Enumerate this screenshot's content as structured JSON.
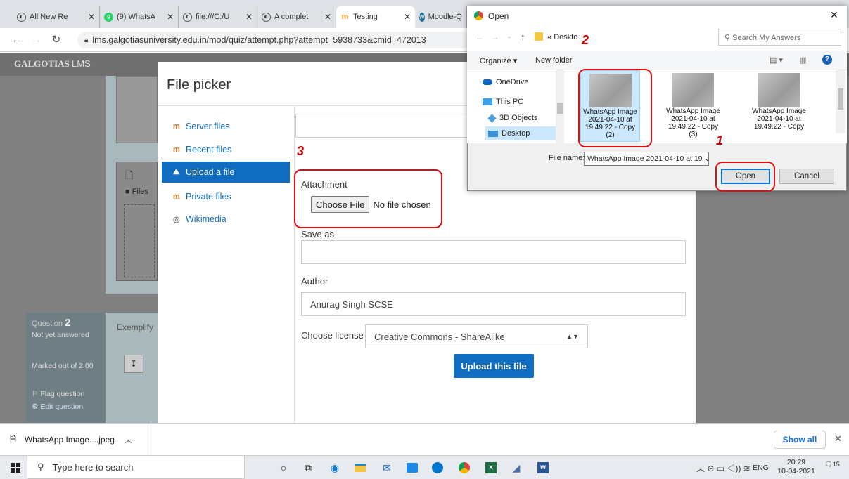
{
  "browser": {
    "tabs": [
      {
        "label": "All New Re",
        "icon": "globe-icon"
      },
      {
        "label": "(9) WhatsA",
        "icon": "whatsapp-icon"
      },
      {
        "label": "file:///C:/U",
        "icon": "globe-icon"
      },
      {
        "label": "A complet",
        "icon": "globe-icon"
      },
      {
        "label": "Testing",
        "icon": "moodle-icon"
      },
      {
        "label": "Moodle-Q",
        "icon": "wordpress-icon"
      }
    ],
    "url": "lms.galgotiasuniversity.edu.in/mod/quiz/attempt.php?attempt=5938733&cmid=472013"
  },
  "lms": {
    "logo": "GALGOTIAS",
    "logo_suffix": "LMS",
    "question_label": "Question",
    "question_number": "2",
    "status": "Not yet answered",
    "marked": "Marked out of 2.00",
    "flag": "Flag question",
    "edit": "Edit question",
    "exemplify": "Exemplify",
    "files_label": "Files"
  },
  "file_picker": {
    "title": "File picker",
    "repositories": [
      {
        "label": "Server files",
        "icon": "moodle-icon"
      },
      {
        "label": "Recent files",
        "icon": "moodle-icon"
      },
      {
        "label": "Upload a file",
        "icon": "upload-icon"
      },
      {
        "label": "Private files",
        "icon": "moodle-icon"
      },
      {
        "label": "Wikimedia",
        "icon": "wikimedia-icon"
      }
    ],
    "attachment_label": "Attachment",
    "choose_file_button": "Choose File",
    "no_file_text": "No file chosen",
    "save_as_label": "Save as",
    "save_as_value": "",
    "author_label": "Author",
    "author_value": "Anurag Singh SCSE",
    "license_label": "Choose license",
    "license_value": "Creative Commons - ShareAlike",
    "upload_button": "Upload this file"
  },
  "open_dialog": {
    "title": "Open",
    "path": "Deskto",
    "search_placeholder": "Search My Answers",
    "organize": "Organize",
    "new_folder": "New folder",
    "nav_items": [
      "OneDrive",
      "This PC",
      "3D Objects",
      "Desktop"
    ],
    "files": [
      {
        "name": "WhatsApp Image 2021-04-10 at 19.49.22 - Copy (2)"
      },
      {
        "name": "WhatsApp Image 2021-04-10 at 19.49.22 - Copy (3)"
      },
      {
        "name": "WhatsApp Image 2021-04-10 at 19.49.22 - Copy"
      }
    ],
    "file_name_label": "File name:",
    "file_name_value": "WhatsApp Image 2021-04-10 at 19",
    "open_button": "Open",
    "cancel_button": "Cancel"
  },
  "annotations": {
    "one": "1",
    "two": "2",
    "three": "3"
  },
  "download_bar": {
    "file": "WhatsApp Image....jpeg",
    "show_all": "Show all"
  },
  "taskbar": {
    "search_placeholder": "Type here to search",
    "time": "20:29",
    "date": "10-04-2021",
    "lang": "ENG",
    "notifications": "15"
  },
  "colors": {
    "accent": "#0f6cbf",
    "annotation": "#dd1111",
    "selected": "#cce8ff"
  }
}
